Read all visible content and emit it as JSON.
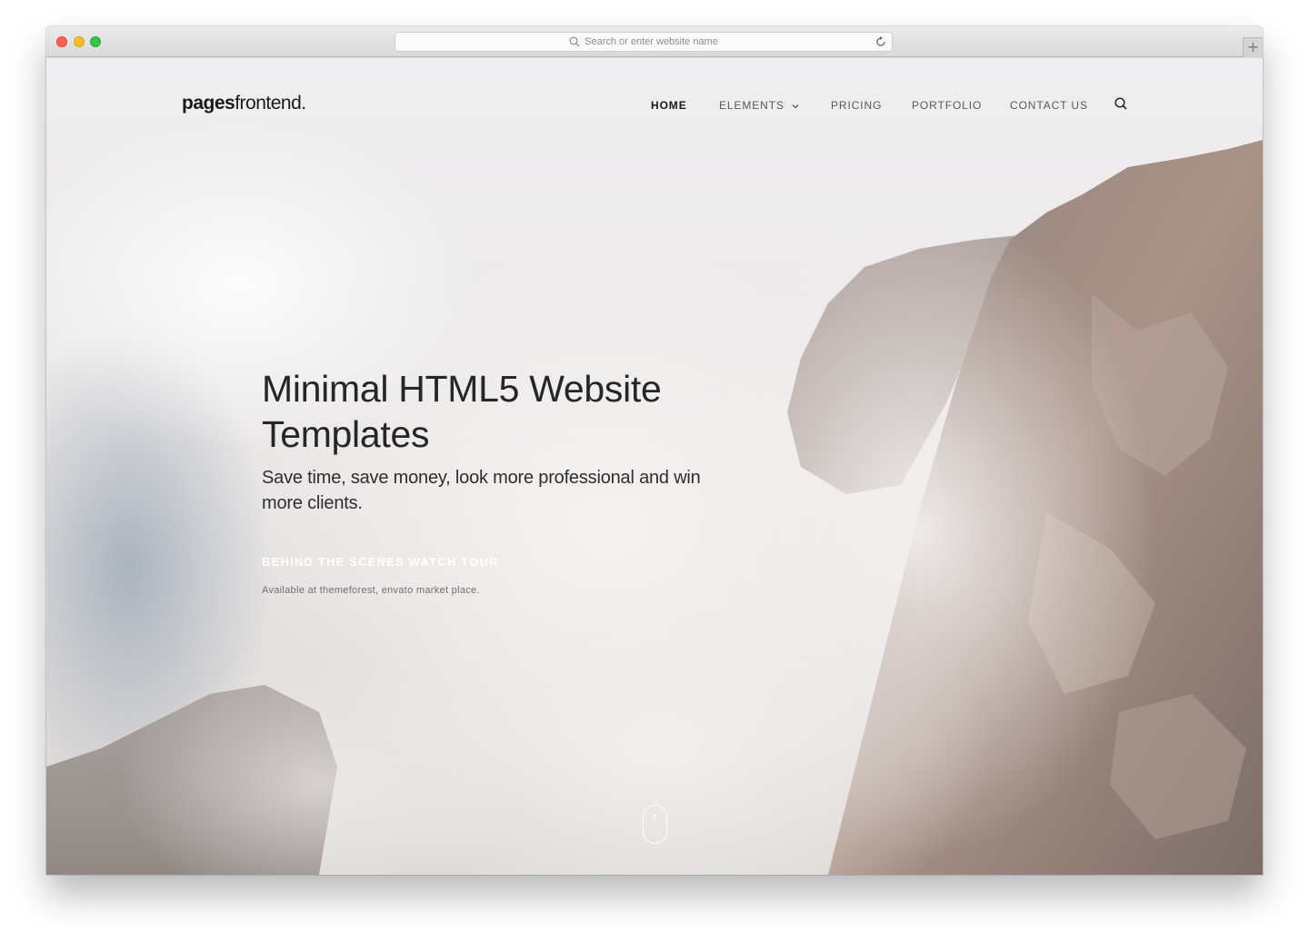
{
  "browser": {
    "url_placeholder": "Search or enter website name",
    "new_tab_label": "+"
  },
  "site": {
    "logo_bold": "pages",
    "logo_light": "frontend."
  },
  "nav": {
    "items": [
      {
        "label": "HOME",
        "active": true
      },
      {
        "label": "ELEMENTS",
        "has_dropdown": true
      },
      {
        "label": "PRICING"
      },
      {
        "label": "PORTFOLIO"
      },
      {
        "label": "CONTACT US"
      }
    ],
    "search_icon": "search-icon"
  },
  "hero": {
    "title": "Minimal HTML5 Website Templates",
    "subtitle": "Save time, save money, look more professional and win more clients.",
    "cta": "BEHIND THE SCENES WATCH TOUR",
    "note": "Available at themeforest, envato market place.",
    "scroll_icon": "mouse-scroll-icon"
  },
  "colors": {
    "text_dark": "#262626",
    "nav_muted": "#595959",
    "cta": "#ffffff"
  }
}
